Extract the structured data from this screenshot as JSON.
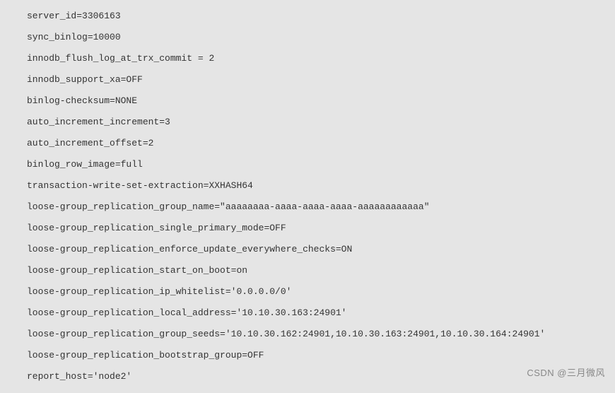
{
  "config": {
    "lines": [
      "server_id=3306163",
      "sync_binlog=10000",
      "innodb_flush_log_at_trx_commit = 2",
      "innodb_support_xa=OFF",
      "binlog-checksum=NONE",
      "auto_increment_increment=3",
      "auto_increment_offset=2",
      "binlog_row_image=full",
      "transaction-write-set-extraction=XXHASH64",
      "loose-group_replication_group_name=\"aaaaaaaa-aaaa-aaaa-aaaa-aaaaaaaaaaaa\"",
      "loose-group_replication_single_primary_mode=OFF",
      "loose-group_replication_enforce_update_everywhere_checks=ON",
      "loose-group_replication_start_on_boot=on",
      "loose-group_replication_ip_whitelist='0.0.0.0/0'",
      "loose-group_replication_local_address='10.10.30.163:24901'",
      "loose-group_replication_group_seeds='10.10.30.162:24901,10.10.30.163:24901,10.10.30.164:24901'",
      "loose-group_replication_bootstrap_group=OFF",
      "report_host='node2'"
    ]
  },
  "watermark": "CSDN @三月微风"
}
